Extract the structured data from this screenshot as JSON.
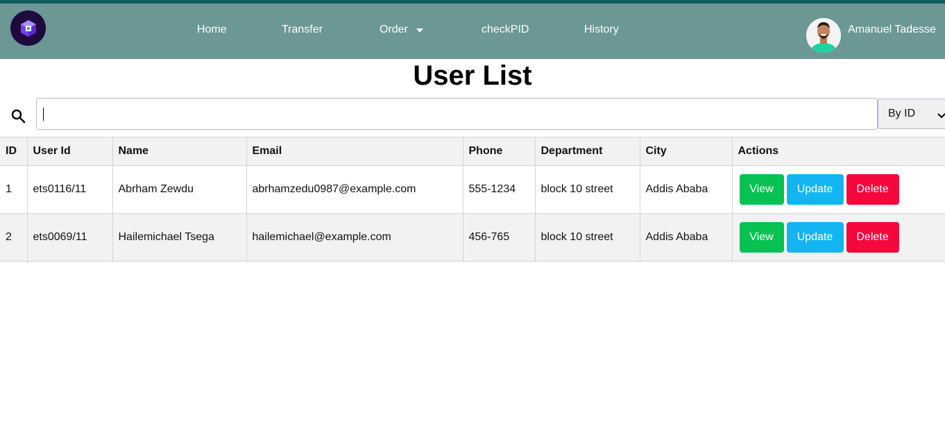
{
  "nav": {
    "items": [
      {
        "label": "Home"
      },
      {
        "label": "Transfer"
      },
      {
        "label": "Order"
      },
      {
        "label": "checkPID"
      },
      {
        "label": "History"
      }
    ],
    "user_name": "Amanuel Tadesse"
  },
  "page": {
    "title": "User List"
  },
  "search": {
    "value": "",
    "filter_selected": "By ID"
  },
  "table": {
    "headers": [
      "ID",
      "User Id",
      "Name",
      "Email",
      "Phone",
      "Department",
      "City",
      "Actions"
    ],
    "rows": [
      {
        "id": "1",
        "user_id": "ets0116/11",
        "name": "Abrham Zewdu",
        "email": "abrhamzedu0987@example.com",
        "phone": "555-1234",
        "department": "block 10 street",
        "city": "Addis Ababa"
      },
      {
        "id": "2",
        "user_id": "ets0069/11",
        "name": "Hailemichael Tsega",
        "email": "hailemichael@example.com",
        "phone": "456-765",
        "department": "block 10 street",
        "city": "Addis Ababa"
      }
    ],
    "actions": {
      "view": "View",
      "update": "Update",
      "delete": "Delete"
    }
  },
  "colors": {
    "navbar": "#6b9795",
    "view_button": "#06c253",
    "update_button": "#12b5f2",
    "delete_button": "#f3073c"
  }
}
